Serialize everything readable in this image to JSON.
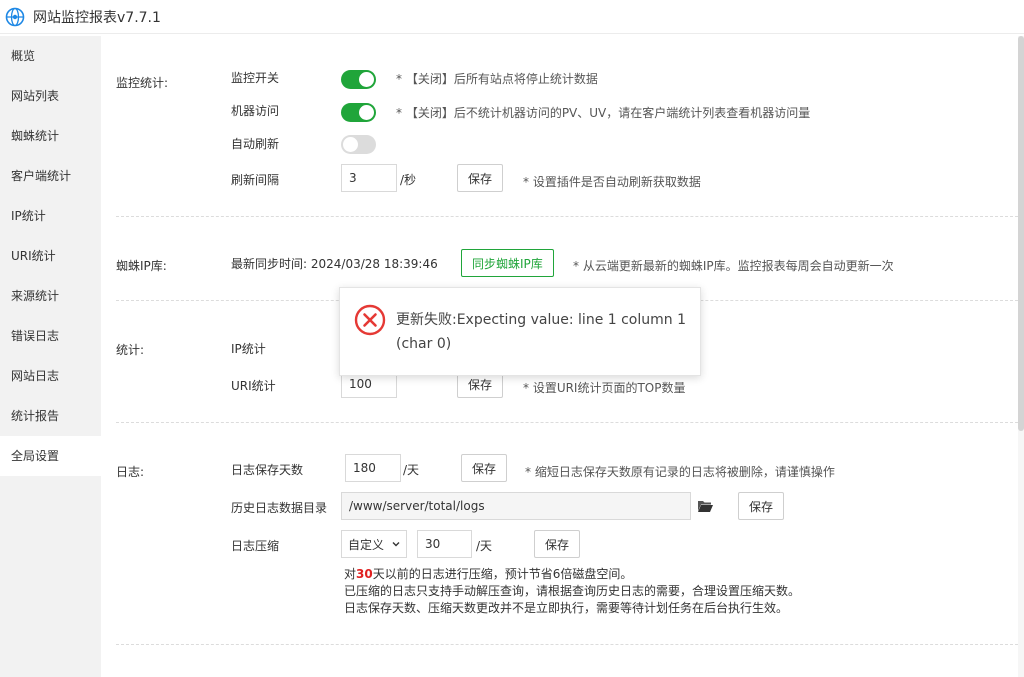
{
  "window": {
    "title": "网站监控报表v7.7.1",
    "logo_icon": "globe-logo-icon",
    "accent": "#20a53a"
  },
  "sidebar": {
    "items": [
      {
        "label": "概览",
        "active": false
      },
      {
        "label": "网站列表",
        "active": false
      },
      {
        "label": "蜘蛛统计",
        "active": false
      },
      {
        "label": "客户端统计",
        "active": false
      },
      {
        "label": "IP统计",
        "active": false
      },
      {
        "label": "URI统计",
        "active": false
      },
      {
        "label": "来源统计",
        "active": false
      },
      {
        "label": "错误日志",
        "active": false
      },
      {
        "label": "网站日志",
        "active": false
      },
      {
        "label": "统计报告",
        "active": false
      },
      {
        "label": "全局设置",
        "active": true
      }
    ]
  },
  "monitor": {
    "section_label": "监控统计:",
    "switch": {
      "label": "监控开关",
      "on": true,
      "hint": "* 【关闭】后所有站点将停止统计数据"
    },
    "bot": {
      "label": "机器访问",
      "on": true,
      "hint": "* 【关闭】后不统计机器访问的PV、UV，请在客户端统计列表查看机器访问量"
    },
    "auto_refresh": {
      "label": "自动刷新",
      "on": false
    },
    "interval": {
      "label": "刷新间隔",
      "value": "3",
      "unit": "/秒",
      "save": "保存",
      "hint": "* 设置插件是否自动刷新获取数据"
    }
  },
  "spider": {
    "section_label": "蜘蛛IP库:",
    "sync_time": "最新同步时间: 2024/03/28 18:39:46",
    "sync_button": "同步蜘蛛IP库",
    "hint": "* 从云端更新最新的蜘蛛IP库。监控报表每周会自动更新一次"
  },
  "stats": {
    "section_label": "统计:",
    "ip": {
      "label": "IP统计"
    },
    "uri": {
      "label": "URI统计",
      "value": "100",
      "save": "保存",
      "hint": "* 设置URI统计页面的TOP数量"
    }
  },
  "logs": {
    "section_label": "日志:",
    "retention": {
      "label": "日志保存天数",
      "value": "180",
      "unit": "/天",
      "save": "保存",
      "hint": "* 缩短日志保存天数原有记录的日志将被删除，请谨慎操作"
    },
    "history_dir": {
      "label": "历史日志数据目录",
      "value": "/www/server/total/logs",
      "save": "保存"
    },
    "compress": {
      "label": "日志压缩",
      "mode": "自定义",
      "value": "30",
      "unit": "/天",
      "save": "保存"
    },
    "notes": {
      "line1_prefix": "对",
      "line1_days": "30",
      "line1_suffix": "天以前的日志进行压缩，预计节省6倍磁盘空间。",
      "line2": "已压缩的日志只支持手动解压查询，请根据查询历史日志的需要，合理设置压缩天数。",
      "line3": "日志保存天数、压缩天数更改并不是立即执行，需要等待计划任务在后台执行生效。"
    }
  },
  "error_modal": {
    "message": "更新失败:Expecting value: line 1 column 1 (char 0)",
    "icon": "error-x-icon",
    "color": "#e53935"
  }
}
